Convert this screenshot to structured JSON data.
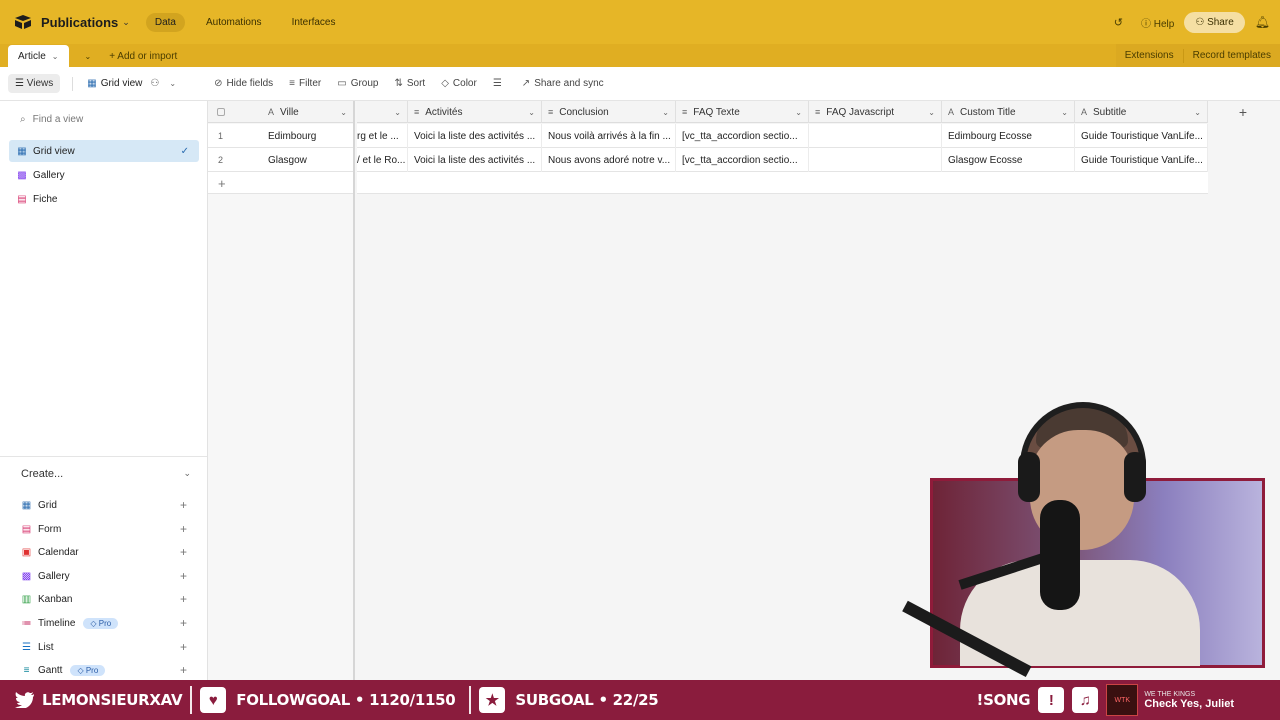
{
  "topbar": {
    "base_name": "Publications",
    "nav": [
      "Data",
      "Automations",
      "Interfaces"
    ],
    "help_label": "Help",
    "share_label": "Share"
  },
  "tabbar": {
    "active_table": "Article",
    "add_import_label": "Add or import",
    "extensions_label": "Extensions",
    "record_templates_label": "Record templates"
  },
  "viewbar": {
    "views_label": "Views",
    "current_view": "Grid view",
    "hide_fields": "Hide fields",
    "filter": "Filter",
    "group": "Group",
    "sort": "Sort",
    "color": "Color",
    "share_sync": "Share and sync"
  },
  "sidebar": {
    "find_placeholder": "Find a view",
    "views": [
      {
        "label": "Grid view",
        "icon": "grid-icon",
        "active": true
      },
      {
        "label": "Gallery",
        "icon": "gallery-icon",
        "active": false
      },
      {
        "label": "Fiche",
        "icon": "form-icon",
        "active": false
      }
    ],
    "create_label": "Create...",
    "create_items": [
      {
        "label": "Grid",
        "icon": "grid-icon",
        "pro": false
      },
      {
        "label": "Form",
        "icon": "form-icon",
        "pro": false
      },
      {
        "label": "Calendar",
        "icon": "calendar-icon",
        "pro": false
      },
      {
        "label": "Gallery",
        "icon": "gallery-icon",
        "pro": false
      },
      {
        "label": "Kanban",
        "icon": "kanban-icon",
        "pro": false
      },
      {
        "label": "Timeline",
        "icon": "timeline-icon",
        "pro": true
      },
      {
        "label": "List",
        "icon": "list-icon",
        "pro": false
      },
      {
        "label": "Gantt",
        "icon": "gantt-icon",
        "pro": true
      }
    ],
    "pro_label": "Pro"
  },
  "grid": {
    "frozen_column": "Ville",
    "columns": [
      "",
      "Activités",
      "Conclusion",
      "FAQ Texte",
      "FAQ Javascript",
      "Custom Title",
      "Subtitle"
    ],
    "rows": [
      {
        "num": "1",
        "ville": "Edimbourg",
        "cells": [
          "rg et le ...",
          "Voici la liste des activités ...",
          "Nous voilà arrivés à la fin ...",
          "[vc_tta_accordion sectio...",
          "",
          "Edimbourg Ecosse",
          "Guide Touristique VanLife..."
        ]
      },
      {
        "num": "2",
        "ville": "Glasgow",
        "cells": [
          "/ et le Ro...",
          "Voici la liste des activités ...",
          "Nous avons adoré notre v...",
          "[vc_tta_accordion sectio...",
          "",
          "Glasgow Ecosse",
          "Guide Touristique VanLife..."
        ]
      }
    ]
  },
  "streambar": {
    "channel": "LEMONSIEURXAV",
    "followgoal": "FOLLOWGOAL • 1120/1150",
    "subgoal": "SUBGOAL • 22/25",
    "song_cmd": "!SONG",
    "now_playing_artist": "WE THE KINGS",
    "now_playing_title": "Check Yes, Juliet"
  }
}
